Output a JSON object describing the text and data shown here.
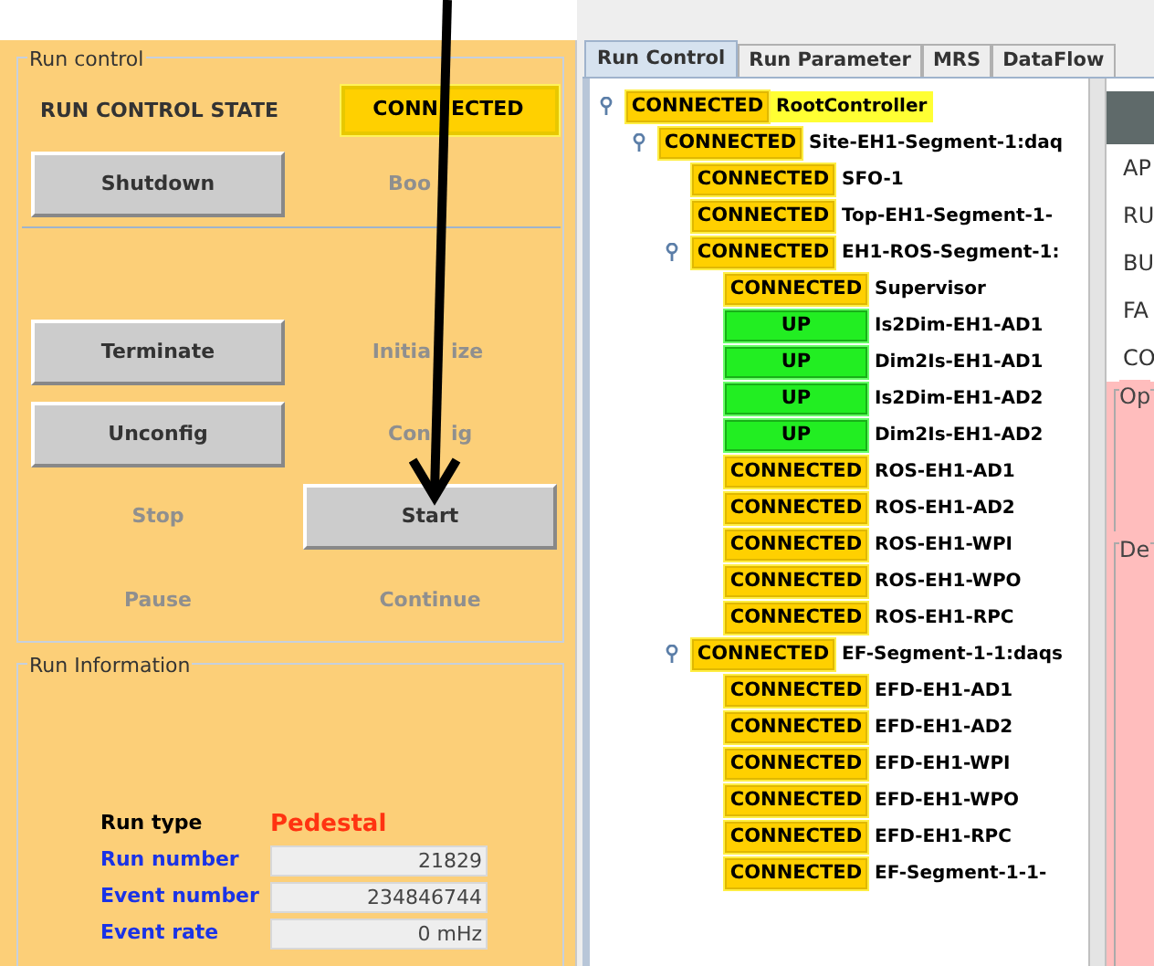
{
  "run_control": {
    "title": "Run control",
    "state_label": "RUN CONTROL STATE",
    "state_parts": [
      "CONN",
      "ECTED"
    ],
    "buttons": [
      {
        "label": "Shutdown",
        "disabled": false
      },
      {
        "label_parts": [
          "Boo"
        ],
        "disabled": true
      },
      {
        "label": "Terminate",
        "disabled": false
      },
      {
        "label_parts": [
          "Initia",
          "ize"
        ],
        "disabled": true
      },
      {
        "label": "Unconfig",
        "disabled": false
      },
      {
        "label_parts": [
          "Con",
          "ig"
        ],
        "disabled": true
      },
      {
        "label": "Stop",
        "disabled": true
      },
      {
        "label": "Start",
        "disabled": false
      },
      {
        "label": "Pause",
        "disabled": true
      },
      {
        "label": "Continue",
        "disabled": true
      }
    ]
  },
  "run_information": {
    "title": "Run Information",
    "rows": [
      {
        "label": "Run type",
        "color": "#000000",
        "kind": "text",
        "value": "Pedestal"
      },
      {
        "label": "Run number",
        "color": "#1a33e6",
        "kind": "field",
        "value": "21829"
      },
      {
        "label": "Event number",
        "color": "#1a33e6",
        "kind": "field",
        "value": "234846744"
      },
      {
        "label": "Event rate",
        "color": "#1a33e6",
        "kind": "field",
        "value": "0 mHz"
      }
    ]
  },
  "tabs": [
    {
      "label": "Run Control",
      "selected": true
    },
    {
      "label": "Run Parameter",
      "selected": false
    },
    {
      "label": "MRS",
      "selected": false
    },
    {
      "label": "DataFlow",
      "selected": false
    }
  ],
  "tree": [
    {
      "state": "CONNECTED",
      "kind": "connected",
      "name": "RootController",
      "selected": true,
      "children": [
        {
          "state": "CONNECTED",
          "kind": "connected",
          "name": "Site-EH1-Segment-1:daq",
          "selected": false,
          "children": [
            {
              "state": "CONNECTED",
              "kind": "connected",
              "name": "SFO-1",
              "selected": false
            },
            {
              "state": "CONNECTED",
              "kind": "connected",
              "name": "Top-EH1-Segment-1-",
              "selected": false
            },
            {
              "state": "CONNECTED",
              "kind": "connected",
              "name": "EH1-ROS-Segment-1:",
              "selected": false,
              "children": [
                {
                  "state": "CONNECTED",
                  "kind": "connected",
                  "name": "Supervisor",
                  "selected": false
                },
                {
                  "state": "UP",
                  "kind": "up",
                  "name": "Is2Dim-EH1-AD1",
                  "selected": false
                },
                {
                  "state": "UP",
                  "kind": "up",
                  "name": "Dim2Is-EH1-AD1",
                  "selected": false
                },
                {
                  "state": "UP",
                  "kind": "up",
                  "name": "Is2Dim-EH1-AD2",
                  "selected": false
                },
                {
                  "state": "UP",
                  "kind": "up",
                  "name": "Dim2Is-EH1-AD2",
                  "selected": false
                },
                {
                  "state": "CONNECTED",
                  "kind": "connected",
                  "name": "ROS-EH1-AD1",
                  "selected": false
                },
                {
                  "state": "CONNECTED",
                  "kind": "connected",
                  "name": "ROS-EH1-AD2",
                  "selected": false
                },
                {
                  "state": "CONNECTED",
                  "kind": "connected",
                  "name": "ROS-EH1-WPI",
                  "selected": false
                },
                {
                  "state": "CONNECTED",
                  "kind": "connected",
                  "name": "ROS-EH1-WPO",
                  "selected": false
                },
                {
                  "state": "CONNECTED",
                  "kind": "connected",
                  "name": "ROS-EH1-RPC",
                  "selected": false
                }
              ]
            },
            {
              "state": "CONNECTED",
              "kind": "connected",
              "name": "EF-Segment-1-1:daqs",
              "selected": false,
              "children": [
                {
                  "state": "CONNECTED",
                  "kind": "connected",
                  "name": "EFD-EH1-AD1",
                  "selected": false
                },
                {
                  "state": "CONNECTED",
                  "kind": "connected",
                  "name": "EFD-EH1-AD2",
                  "selected": false
                },
                {
                  "state": "CONNECTED",
                  "kind": "connected",
                  "name": "EFD-EH1-WPI",
                  "selected": false
                },
                {
                  "state": "CONNECTED",
                  "kind": "connected",
                  "name": "EFD-EH1-WPO",
                  "selected": false
                },
                {
                  "state": "CONNECTED",
                  "kind": "connected",
                  "name": "EFD-EH1-RPC",
                  "selected": false
                },
                {
                  "state": "CONNECTED",
                  "kind": "connected",
                  "name": "EF-Segment-1-1-",
                  "selected": false
                }
              ]
            }
          ]
        }
      ]
    }
  ],
  "side_panel": {
    "labels": [
      "AP",
      "RU",
      "BU",
      "FA",
      "CO"
    ],
    "group_1": "Op",
    "group_2": "De"
  }
}
